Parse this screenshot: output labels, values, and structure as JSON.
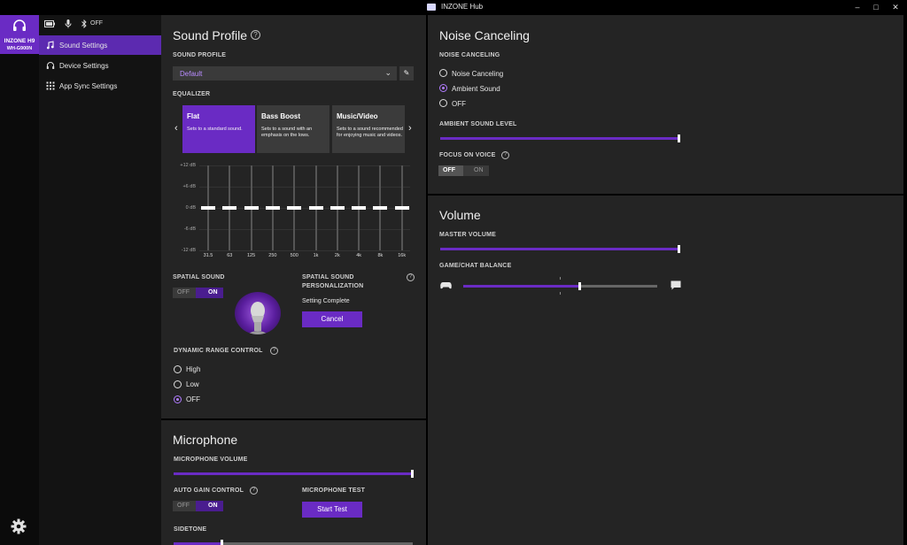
{
  "window": {
    "title": "INZONE Hub",
    "controls": [
      "–",
      "□",
      "✕"
    ]
  },
  "device": {
    "name": "INZONE H9",
    "model": "WH-G900N"
  },
  "status": {
    "bluetooth": "OFF"
  },
  "nav": [
    {
      "label": "Sound Settings",
      "icon": "music-note-icon",
      "active": true
    },
    {
      "label": "Device Settings",
      "icon": "headphones-icon",
      "active": false
    },
    {
      "label": "App Sync Settings",
      "icon": "grid-icon",
      "active": false
    }
  ],
  "sound_profile": {
    "title": "Sound Profile",
    "profile_label": "SOUND PROFILE",
    "profile_value": "Default",
    "equalizer_label": "EQUALIZER",
    "presets": [
      {
        "title": "Flat",
        "desc": "Sets to a standard sound."
      },
      {
        "title": "Bass Boost",
        "desc": "Sets to a sound with an emphasis on the lows."
      },
      {
        "title": "Music/Video",
        "desc": "Sets to a sound recommended for enjoying music and videos."
      }
    ],
    "eq_db_labels": [
      "+12 dB",
      "+6 dB",
      "0 dB",
      "-6 dB",
      "-12 dB"
    ],
    "eq_bands": [
      "31.5",
      "63",
      "125",
      "250",
      "500",
      "1k",
      "2k",
      "4k",
      "8k",
      "16k"
    ],
    "eq_values_db": [
      0,
      0,
      0,
      0,
      0,
      0,
      0,
      0,
      0,
      0
    ],
    "spatial_label": "SPATIAL SOUND",
    "spatial_off": "OFF",
    "spatial_on": "ON",
    "personalization_label_1": "SPATIAL SOUND",
    "personalization_label_2": "PERSONALIZATION",
    "personalization_status": "Setting Complete",
    "cancel_label": "Cancel",
    "drc_label": "DYNAMIC RANGE CONTROL",
    "drc_options": [
      "High",
      "Low",
      "OFF"
    ],
    "drc_selected": "OFF"
  },
  "microphone": {
    "title": "Microphone",
    "volume_label": "MICROPHONE VOLUME",
    "volume_level": 1.0,
    "agc_label": "AUTO GAIN CONTROL",
    "agc_off": "OFF",
    "agc_on": "ON",
    "test_label": "MICROPHONE TEST",
    "start_test_label": "Start Test",
    "sidetone_label": "SIDETONE",
    "sidetone_level": 0.2
  },
  "noise_canceling": {
    "title": "Noise Canceling",
    "section_label": "NOISE CANCELING",
    "options": [
      "Noise Canceling",
      "Ambient Sound",
      "OFF"
    ],
    "selected": "Ambient Sound",
    "ambient_label": "AMBIENT SOUND LEVEL",
    "ambient_level": 1.0,
    "focus_label": "FOCUS ON VOICE",
    "focus_off": "OFF",
    "focus_on": "ON"
  },
  "volume": {
    "title": "Volume",
    "master_label": "MASTER VOLUME",
    "master_level": 1.0,
    "balance_label": "GAME/CHAT BALANCE",
    "balance_level": 0.6
  },
  "colors": {
    "accent": "#6a2bc4",
    "panel": "#242424",
    "nav": "#131313"
  }
}
